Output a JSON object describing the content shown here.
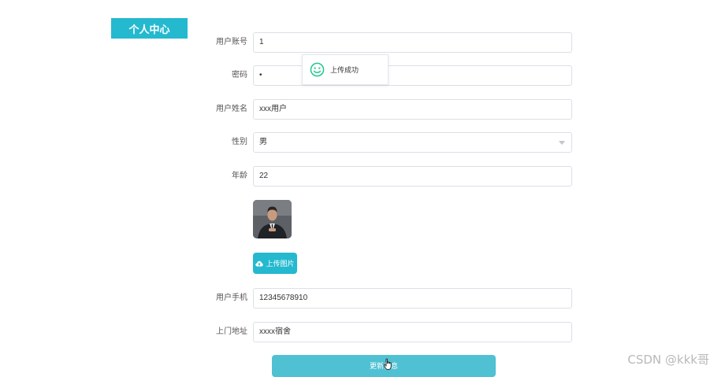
{
  "nav": {
    "tab_label": "个人中心"
  },
  "form": {
    "fields": [
      {
        "label": "用户账号",
        "value": "1"
      },
      {
        "label": "密码",
        "value": "•"
      },
      {
        "label": "用户姓名",
        "value": "xxx用户"
      },
      {
        "label": "性别",
        "value": "男"
      },
      {
        "label": "年龄",
        "value": "22"
      },
      {
        "label": "用户手机",
        "value": "12345678910"
      },
      {
        "label": "上门地址",
        "value": "xxxx宿舍"
      }
    ],
    "upload_label": "上传图片",
    "submit_label": "更新信息"
  },
  "toast": {
    "message": "上传成功"
  },
  "watermark": "CSDN @kkk哥",
  "colors": {
    "accent": "#24b9cf",
    "success": "#21c78a"
  }
}
